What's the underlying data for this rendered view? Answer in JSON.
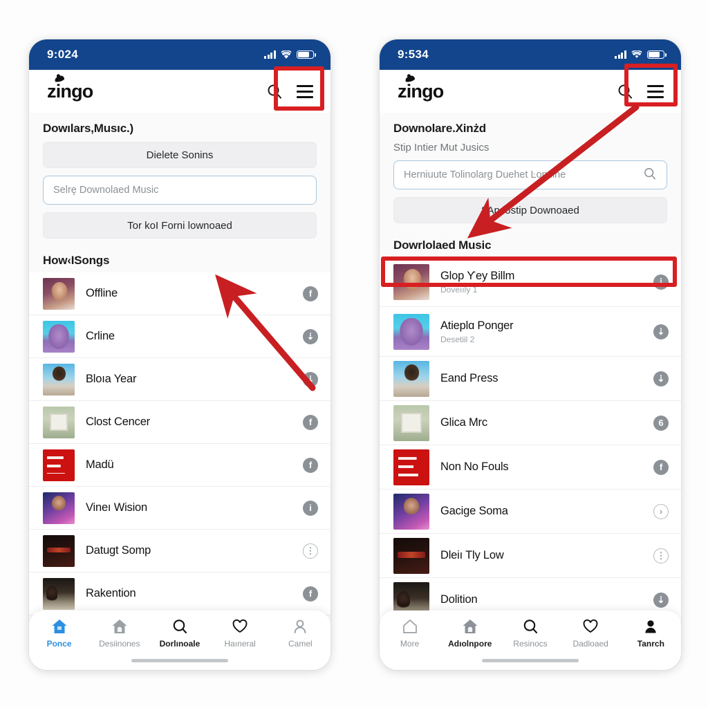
{
  "accent": {
    "status_bar_blue": "#12458c",
    "annotation_red": "#d81f22",
    "tab_active_blue": "#2d8fe0",
    "field_border": "#a9c6dc",
    "action_circle": "#8b9197"
  },
  "phones": [
    {
      "id": "left",
      "status": {
        "time": "9:024",
        "signal_icon": "cellular-signal-icon",
        "wifi_icon": "wifi-icon",
        "battery_icon": "battery-icon"
      },
      "header": {
        "brand": "zingo",
        "search_icon": "search-icon",
        "menu_icon": "hamburger-menu-icon"
      },
      "section_title": "Dowılars,Musıc.)",
      "buttons": [
        {
          "label": "Dielete Sonins",
          "name": "delete-songs-button"
        },
        {
          "label": "Tor koI Forni lownoaed",
          "name": "format-download-button"
        }
      ],
      "field": {
        "value": "Selrę Downolaed Music",
        "name": "select-downloaded-music-field"
      },
      "list_header": "How‹ISongs",
      "songs": [
        {
          "title": "Offline",
          "sub": "",
          "thumb": "tb-girl",
          "action": "f"
        },
        {
          "title": "Crline",
          "sub": "",
          "thumb": "tb-purple",
          "action": "d"
        },
        {
          "title": "Bloıa Year",
          "sub": "",
          "thumb": "tb-man",
          "action": "d"
        },
        {
          "title": "Clost Cencer",
          "sub": "",
          "thumb": "tb-house",
          "action": "f"
        },
        {
          "title": "Madü",
          "sub": "",
          "thumb": "tb-red",
          "action": "f"
        },
        {
          "title": "Vineı Wision",
          "sub": "",
          "thumb": "tb-neon",
          "action": "i"
        },
        {
          "title": "Datugt Somp",
          "sub": "",
          "thumb": "tb-dark",
          "action": "hollow-i"
        },
        {
          "title": "Rakention",
          "sub": "",
          "thumb": "tb-couple",
          "action": "f"
        }
      ],
      "tabs": [
        {
          "label": "Ponce",
          "icon": "home-filled-icon",
          "state": "active-blue"
        },
        {
          "label": "Desiinones",
          "icon": "home-outline-icon",
          "state": "idle"
        },
        {
          "label": "Dorlınoale",
          "icon": "search-icon",
          "state": "active-dark"
        },
        {
          "label": "Haıneral",
          "icon": "heart-icon",
          "state": "idle"
        },
        {
          "label": "Camel",
          "icon": "person-outline-icon",
          "state": "idle"
        }
      ]
    },
    {
      "id": "right",
      "status": {
        "time": "9:534",
        "signal_icon": "cellular-signal-icon",
        "wifi_icon": "wifi-icon",
        "battery_icon": "battery-icon"
      },
      "header": {
        "brand": "zingo",
        "search_icon": "search-icon",
        "menu_icon": "hamburger-menu-icon"
      },
      "section_title": "Downolare.Xinżd",
      "sub_title": "Stip Intier Mut Jusics",
      "search_field": {
        "placeholder": "Herniuute Tolinolarg Duehet Ŀomline",
        "icon": "search-icon",
        "name": "search-download-field"
      },
      "buttons": [
        {
          "label": "?Apılostip Downoaed",
          "name": "stop-download-button"
        }
      ],
      "list_header": "Dowrlolaed Music",
      "songs": [
        {
          "title": "Glop Ƴey Billm",
          "sub": "Doveııly 1",
          "thumb": "tb-girl",
          "action": "d",
          "highlighted": true
        },
        {
          "title": "Atieplɑ Ponger",
          "sub": "Desetiil 2",
          "thumb": "tb-purple",
          "action": "d"
        },
        {
          "title": "Eand Pɾess",
          "sub": "",
          "thumb": "tb-man",
          "action": "d"
        },
        {
          "title": "Glica Mrc",
          "sub": "",
          "thumb": "tb-house",
          "action": "6"
        },
        {
          "title": "Non No Fouls",
          "sub": "",
          "thumb": "tb-red",
          "action": "f"
        },
        {
          "title": "Gacige Soma",
          "sub": "",
          "thumb": "tb-neon",
          "action": "hollow-chev"
        },
        {
          "title": "Dleiı Tly Low",
          "sub": "",
          "thumb": "tb-dark",
          "action": "hollow-i"
        },
        {
          "title": "Dolition",
          "sub": "",
          "thumb": "tb-couple",
          "action": "d"
        }
      ],
      "tabs": [
        {
          "label": "More",
          "icon": "home-outline-icon",
          "state": "idle"
        },
        {
          "label": "Adıolnpore",
          "icon": "home-filled-icon",
          "state": "active-dark"
        },
        {
          "label": "Resinocs",
          "icon": "search-icon",
          "state": "idle"
        },
        {
          "label": "Dadloaed",
          "icon": "heart-icon",
          "state": "idle"
        },
        {
          "label": "Tanrch",
          "icon": "person-filled-icon",
          "state": "active-dark"
        }
      ]
    }
  ],
  "annotations": {
    "boxes": [
      {
        "name": "highlight-menu-left",
        "note": "red box around left hamburger menu"
      },
      {
        "name": "highlight-menu-right",
        "note": "red box around right hamburger menu"
      },
      {
        "name": "highlight-first-song",
        "note": "red box around first downloaded song row"
      }
    ],
    "arrows": [
      {
        "name": "arrow-to-song-list",
        "note": "red arrow pointing up-left into left song list"
      },
      {
        "name": "arrow-menu-to-list",
        "note": "red arrow from right hamburger menu down to downloaded list"
      }
    ]
  }
}
